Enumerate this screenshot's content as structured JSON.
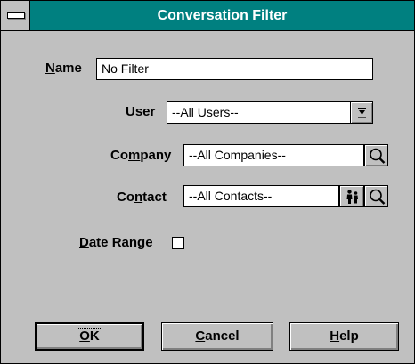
{
  "window": {
    "title": "Conversation Filter"
  },
  "form": {
    "name": {
      "label_u": "N",
      "label_rest": "ame",
      "value": "No Filter"
    },
    "user": {
      "label_u": "U",
      "label_rest": "ser",
      "value": "--All Users--"
    },
    "company": {
      "label_pre": "Co",
      "label_u": "m",
      "label_rest": "pany",
      "value": "--All Companies--"
    },
    "contact": {
      "label_pre": "Co",
      "label_u": "n",
      "label_rest": "tact",
      "value": "--All Contacts--"
    },
    "date_range": {
      "label_u": "D",
      "label_rest": "ate Range",
      "checked": false
    }
  },
  "buttons": {
    "ok": {
      "label_u": "O",
      "label_rest": "K"
    },
    "cancel": {
      "label_u": "C",
      "label_rest": "ancel"
    },
    "help": {
      "label_u": "H",
      "label_rest": "elp"
    }
  },
  "icons": {
    "system_menu": "system-menu-icon",
    "dropdown": "dropdown-arrow-icon",
    "search": "magnifier-icon",
    "people": "people-icon"
  },
  "colors": {
    "titlebar": "#008080",
    "face": "#c0c0c0",
    "field": "#ffffff"
  }
}
